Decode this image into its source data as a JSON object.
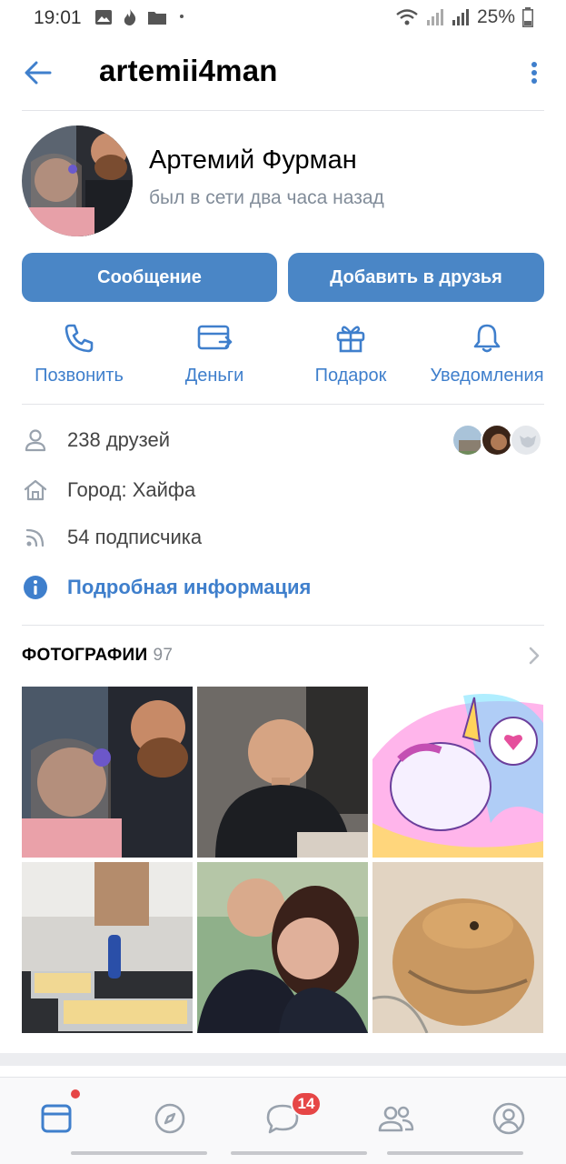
{
  "status_bar": {
    "time": "19:01",
    "battery": "25%"
  },
  "header": {
    "title": "artemii4man"
  },
  "profile": {
    "name": "Артемий Фурман",
    "status": "был в сети два часа назад"
  },
  "buttons": {
    "message": "Сообщение",
    "add_friend": "Добавить в друзья"
  },
  "actions": [
    {
      "label": "Позвонить",
      "icon": "phone-icon"
    },
    {
      "label": "Деньги",
      "icon": "money-transfer-icon"
    },
    {
      "label": "Подарок",
      "icon": "gift-icon"
    },
    {
      "label": "Уведомления",
      "icon": "bell-icon"
    }
  ],
  "info": {
    "friends": "238 друзей",
    "city": "Город: Хайфа",
    "followers": "54 подписчика",
    "details": "Подробная информация"
  },
  "photos": {
    "title": "ФОТОГРАФИИ",
    "count": "97"
  },
  "nav": {
    "messages_badge": "14"
  },
  "colors": {
    "accent": "#4a86c6",
    "link": "#3f7fcc",
    "badge": "#e64646"
  }
}
